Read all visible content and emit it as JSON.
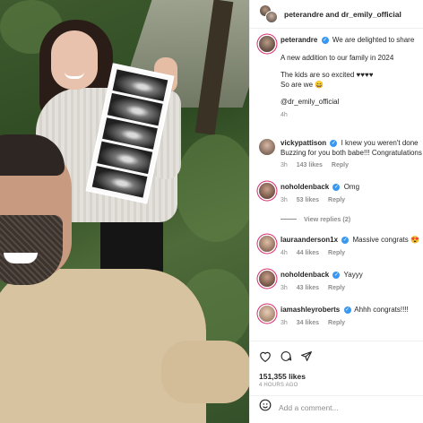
{
  "header": {
    "title": "peterandre and dr_emily_official"
  },
  "caption": {
    "username": "peterandre",
    "lines": [
      "We are delighted to share",
      "A new addition to our family in 2024",
      "The kids are so excited ♥♥♥♥",
      "So are we 😄",
      "@dr_emily_official"
    ],
    "time": "4h"
  },
  "comments": [
    {
      "username": "vickypattison",
      "text": "I knew you weren't done",
      "text2": "Buzzing for you both babe!!! Congratulations",
      "time": "3h",
      "likes": "143 likes",
      "reply": "Reply"
    },
    {
      "username": "noholdenback",
      "text": "Omg",
      "time": "3h",
      "likes": "53 likes",
      "reply": "Reply"
    },
    {
      "username": "lauraanderson1x",
      "text": "Massive congrats 😍",
      "time": "4h",
      "likes": "44 likes",
      "reply": "Reply"
    },
    {
      "username": "noholdenback",
      "text": "Yayyy",
      "time": "3h",
      "likes": "43 likes",
      "reply": "Reply"
    },
    {
      "username": "iamashleyroberts",
      "text": "Ahhh congrats!!!!",
      "time": "3h",
      "likes": "34 likes",
      "reply": "Reply"
    }
  ],
  "view_replies": "View replies (2)",
  "post": {
    "likes": "151,355 likes",
    "ago": "4 HOURS AGO"
  },
  "comment_box": {
    "placeholder": "Add a comment..."
  },
  "icons": {
    "like": "heart-icon",
    "comment": "comment-icon",
    "share": "send-icon",
    "emoji": "emoji-icon",
    "verified": "verified-badge-icon"
  },
  "colors": {
    "verified": "#3897f0",
    "muted": "#8e8e8e",
    "story_ring": "#d92b6d"
  }
}
